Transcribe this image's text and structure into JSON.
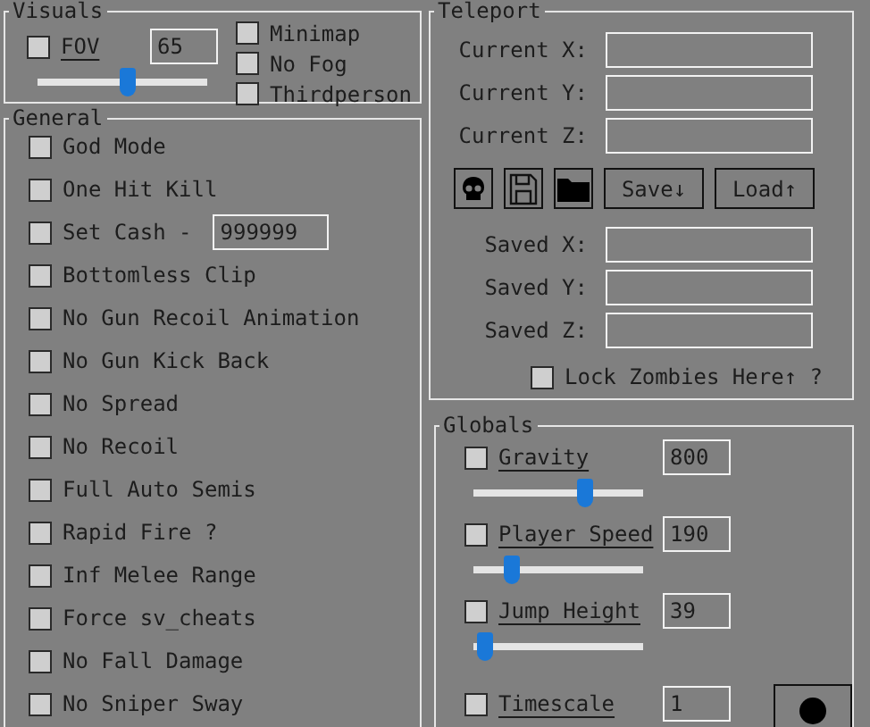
{
  "visuals": {
    "title": "Visuals",
    "fov": {
      "label": "FOV",
      "checked": false,
      "value": "65",
      "level": 0.53
    },
    "checks": [
      {
        "label": "Minimap",
        "checked": false
      },
      {
        "label": "No Fog",
        "checked": false
      },
      {
        "label": "Thirdperson",
        "checked": false
      }
    ]
  },
  "general": {
    "title": "General",
    "items": [
      {
        "kind": "check",
        "label": "God Mode",
        "checked": false
      },
      {
        "kind": "check",
        "label": "One Hit Kill",
        "checked": false
      },
      {
        "kind": "field",
        "label": "Set Cash -",
        "checked": false,
        "value": "999999"
      },
      {
        "kind": "check",
        "label": "Bottomless Clip",
        "checked": false
      },
      {
        "kind": "check",
        "label": "No Gun Recoil Animation",
        "checked": false
      },
      {
        "kind": "check",
        "label": "No Gun Kick Back",
        "checked": false
      },
      {
        "kind": "check",
        "label": "No Spread",
        "checked": false
      },
      {
        "kind": "check",
        "label": "No Recoil",
        "checked": false
      },
      {
        "kind": "check",
        "label": "Full Auto Semis",
        "checked": false
      },
      {
        "kind": "check",
        "label": "Rapid Fire ?",
        "checked": false
      },
      {
        "kind": "check",
        "label": "Inf Melee Range",
        "checked": false
      },
      {
        "kind": "check",
        "label": "Force sv_cheats",
        "checked": false
      },
      {
        "kind": "check",
        "label": "No Fall Damage",
        "checked": false
      },
      {
        "kind": "check",
        "label": "No Sniper Sway",
        "checked": false
      }
    ]
  },
  "teleport": {
    "title": "Teleport",
    "current": [
      {
        "label": "Current X:"
      },
      {
        "label": "Current Y:"
      },
      {
        "label": "Current Z:"
      }
    ],
    "buttons": [
      {
        "kind": "skull"
      },
      {
        "kind": "floppy"
      },
      {
        "kind": "folder"
      },
      {
        "kind": "text",
        "label": "Save↓"
      },
      {
        "kind": "text",
        "label": "Load↑"
      }
    ],
    "saved": [
      {
        "label": "Saved X:"
      },
      {
        "label": "Saved Y:"
      },
      {
        "label": "Saved Z:"
      }
    ],
    "lock": {
      "label": "Lock Zombies Here↑ ?",
      "checked": false
    }
  },
  "globals": {
    "title": "Globals",
    "items": [
      {
        "label": "Gravity",
        "checked": false,
        "value": "800",
        "level": 0.65
      },
      {
        "label": "Player Speed",
        "checked": false,
        "value": "190",
        "level": 0.22
      },
      {
        "label": "Jump Height",
        "checked": false,
        "value": "39",
        "level": 0.06
      },
      {
        "label": "Timescale",
        "checked": false,
        "value": "1"
      }
    ]
  }
}
